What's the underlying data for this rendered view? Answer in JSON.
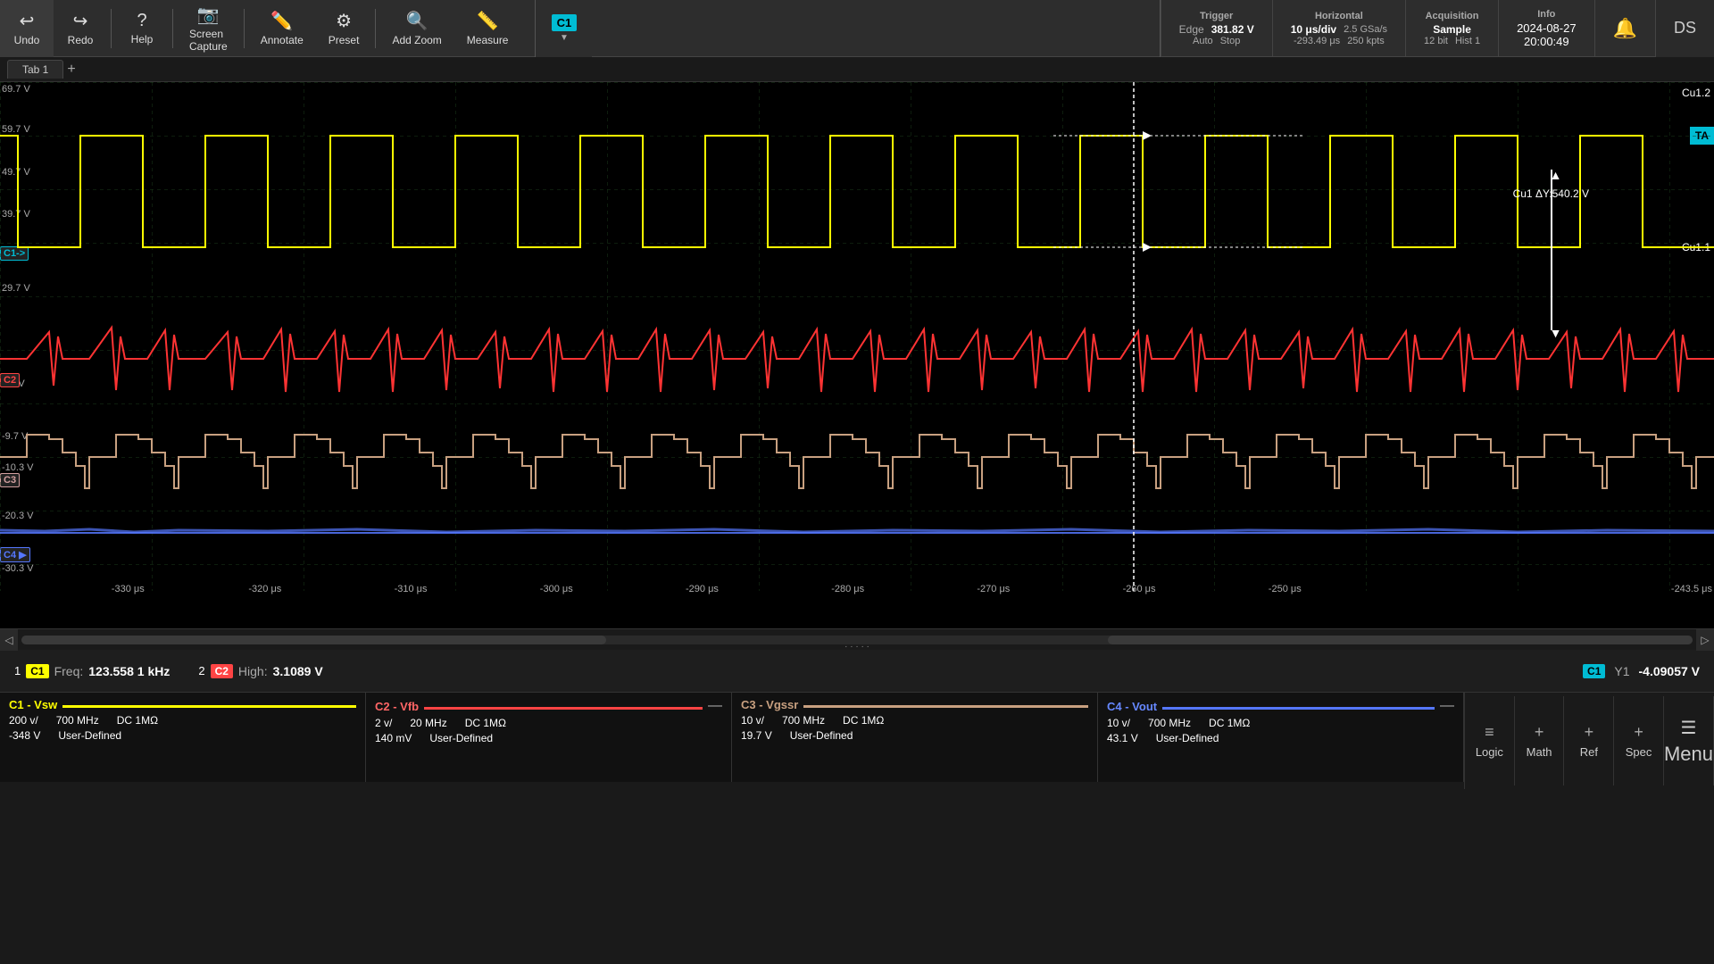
{
  "toolbar": {
    "undo_label": "Undo",
    "redo_label": "Redo",
    "help_label": "Help",
    "screen_capture_label": "Screen\nCapture",
    "annotate_label": "Annotate",
    "preset_label": "Preset",
    "add_zoom_label": "Add Zoom",
    "measure_label": "Measure"
  },
  "trigger": {
    "title": "Trigger",
    "type": "Edge",
    "value": "381.82 V",
    "mode": "Auto",
    "stop": "Stop"
  },
  "horizontal": {
    "title": "Horizontal",
    "div": "10 μs/div",
    "sample_rate": "2.5 GSa/s",
    "position": "-293.49 μs",
    "points": "250 kpts"
  },
  "acquisition": {
    "title": "Acquisition",
    "mode": "Sample",
    "bits": "12 bit",
    "hist": "Hist 1"
  },
  "info": {
    "title": "Info",
    "datetime": "2024-08-27",
    "time": "20:00:49"
  },
  "tab": {
    "name": "Tab 1"
  },
  "y_labels": [
    {
      "val": "69.7 V",
      "pct": 0
    },
    {
      "val": "59.7 V",
      "pct": 9
    },
    {
      "val": "49.7 V",
      "pct": 18
    },
    {
      "val": "39.7 V",
      "pct": 27
    },
    {
      "val": "29.7 V",
      "pct": 44
    },
    {
      "val": "9.7 V",
      "pct": 61
    },
    {
      "val": "-9.7 V",
      "pct": 71
    },
    {
      "val": "-10.3 V",
      "pct": 80
    },
    {
      "val": "-20.3 V",
      "pct": 88
    },
    {
      "val": "-30.3 V",
      "pct": 96
    }
  ],
  "x_labels": [
    {
      "val": "-330 μs",
      "pct": 8
    },
    {
      "val": "-320 μs",
      "pct": 17
    },
    {
      "val": "-310 μs",
      "pct": 26
    },
    {
      "val": "-300 μs",
      "pct": 35
    },
    {
      "val": "-290 μs",
      "pct": 44
    },
    {
      "val": "-280 μs",
      "pct": 53
    },
    {
      "val": "-270 μs",
      "pct": 62
    },
    {
      "val": "-260 μs",
      "pct": 71
    },
    {
      "val": "-250 μs",
      "pct": 80
    },
    {
      "val": "-243.5 μs",
      "pct": 91
    }
  ],
  "annotation": {
    "delta_y": "Cu1 ΔY:540.2 V",
    "cu1_1": "Cu1.1",
    "cu1_2": "Cu1.2",
    "ta": "TA"
  },
  "measurements": [
    {
      "index": "1",
      "ch": "C1",
      "ch_color": "#ffff00",
      "label": "Freq:",
      "value": "123.558 1 kHz"
    },
    {
      "index": "2",
      "ch": "C2",
      "ch_color": "#ff4444",
      "label": "High:",
      "value": "3.1089 V"
    }
  ],
  "y1_readout": {
    "ch": "C1",
    "label": "Y1",
    "value": "-4.09057 V"
  },
  "channels": [
    {
      "id": "C1",
      "name": "C1 - Vsw",
      "color": "#ffff00",
      "color_hex": "#ffff00",
      "voltage_div": "200 v/",
      "offset": "-348 V",
      "bandwidth": "700 MHz",
      "coupling": "DC 1MΩ",
      "defined": "User-Defined",
      "has_minus": false
    },
    {
      "id": "C2",
      "name": "C2 - Vfb",
      "color": "#ff4444",
      "color_hex": "#ff4444",
      "voltage_div": "2 v/",
      "offset": "140 mV",
      "bandwidth": "20 MHz",
      "coupling": "DC 1MΩ",
      "defined": "User-Defined",
      "has_minus": true
    },
    {
      "id": "C3",
      "name": "C3 - Vgssr",
      "color": "#d4a0a0",
      "color_hex": "#d4a0a0",
      "voltage_div": "10 v/",
      "offset": "19.7 V",
      "bandwidth": "700 MHz",
      "coupling": "DC 1MΩ",
      "defined": "User-Defined",
      "has_minus": false
    },
    {
      "id": "C4",
      "name": "C4 - Vout",
      "color": "#5577ff",
      "color_hex": "#5577ff",
      "voltage_div": "10 v/",
      "offset": "43.1 V",
      "bandwidth": "700 MHz",
      "coupling": "DC 1MΩ",
      "defined": "User-Defined",
      "has_minus": true
    }
  ],
  "bottom_btns": [
    {
      "label": "Logic",
      "icon": "≡"
    },
    {
      "label": "Math",
      "icon": "+"
    },
    {
      "label": "Ref",
      "icon": "+"
    },
    {
      "label": "Spec",
      "icon": "+"
    },
    {
      "label": "Menu",
      "icon": "☰"
    }
  ]
}
